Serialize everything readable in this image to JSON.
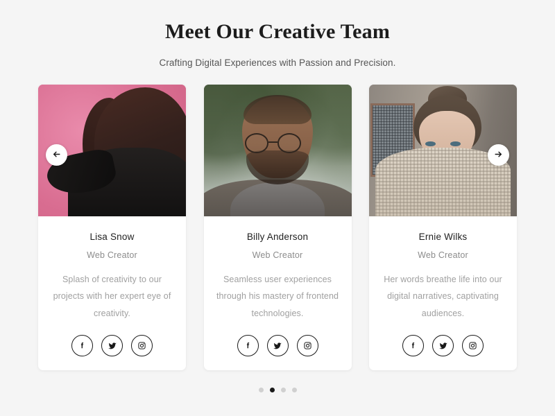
{
  "header": {
    "title": "Meet Our Creative Team",
    "subtitle": "Crafting Digital Experiences with Passion and Precision."
  },
  "carousel": {
    "prev_label": "←",
    "next_label": "→",
    "members": [
      {
        "name": "Lisa Snow",
        "role": "Web Creator",
        "bio": "Splash of creativity to our projects with her expert eye of creativity.",
        "photo_alt": "woman with sunglasses on pink background",
        "socials": [
          "facebook",
          "twitter",
          "instagram"
        ]
      },
      {
        "name": "Billy Anderson",
        "role": "Web Creator",
        "bio": "Seamless user experiences through his mastery of frontend technologies.",
        "photo_alt": "man with glasses outdoors",
        "socials": [
          "facebook",
          "twitter",
          "instagram"
        ]
      },
      {
        "name": "Ernie Wilks",
        "role": "Web Creator",
        "bio": "Her words breathe life into our digital narratives, captivating audiences.",
        "photo_alt": "woman pulling sweater over face",
        "socials": [
          "facebook",
          "twitter",
          "instagram"
        ]
      }
    ],
    "dots": {
      "count": 4,
      "active_index": 1
    }
  },
  "colors": {
    "page_background": "#f5f5f5",
    "card_background": "#ffffff",
    "title_text": "#1c1c1c",
    "subtitle_text": "#555555",
    "name_text": "#1f1f1f",
    "role_text": "#8c8c8c",
    "bio_text": "#a0a0a0",
    "icon_border": "#1a1a1a",
    "dot_inactive": "#d0d0d0",
    "dot_active": "#1a1a1a"
  }
}
